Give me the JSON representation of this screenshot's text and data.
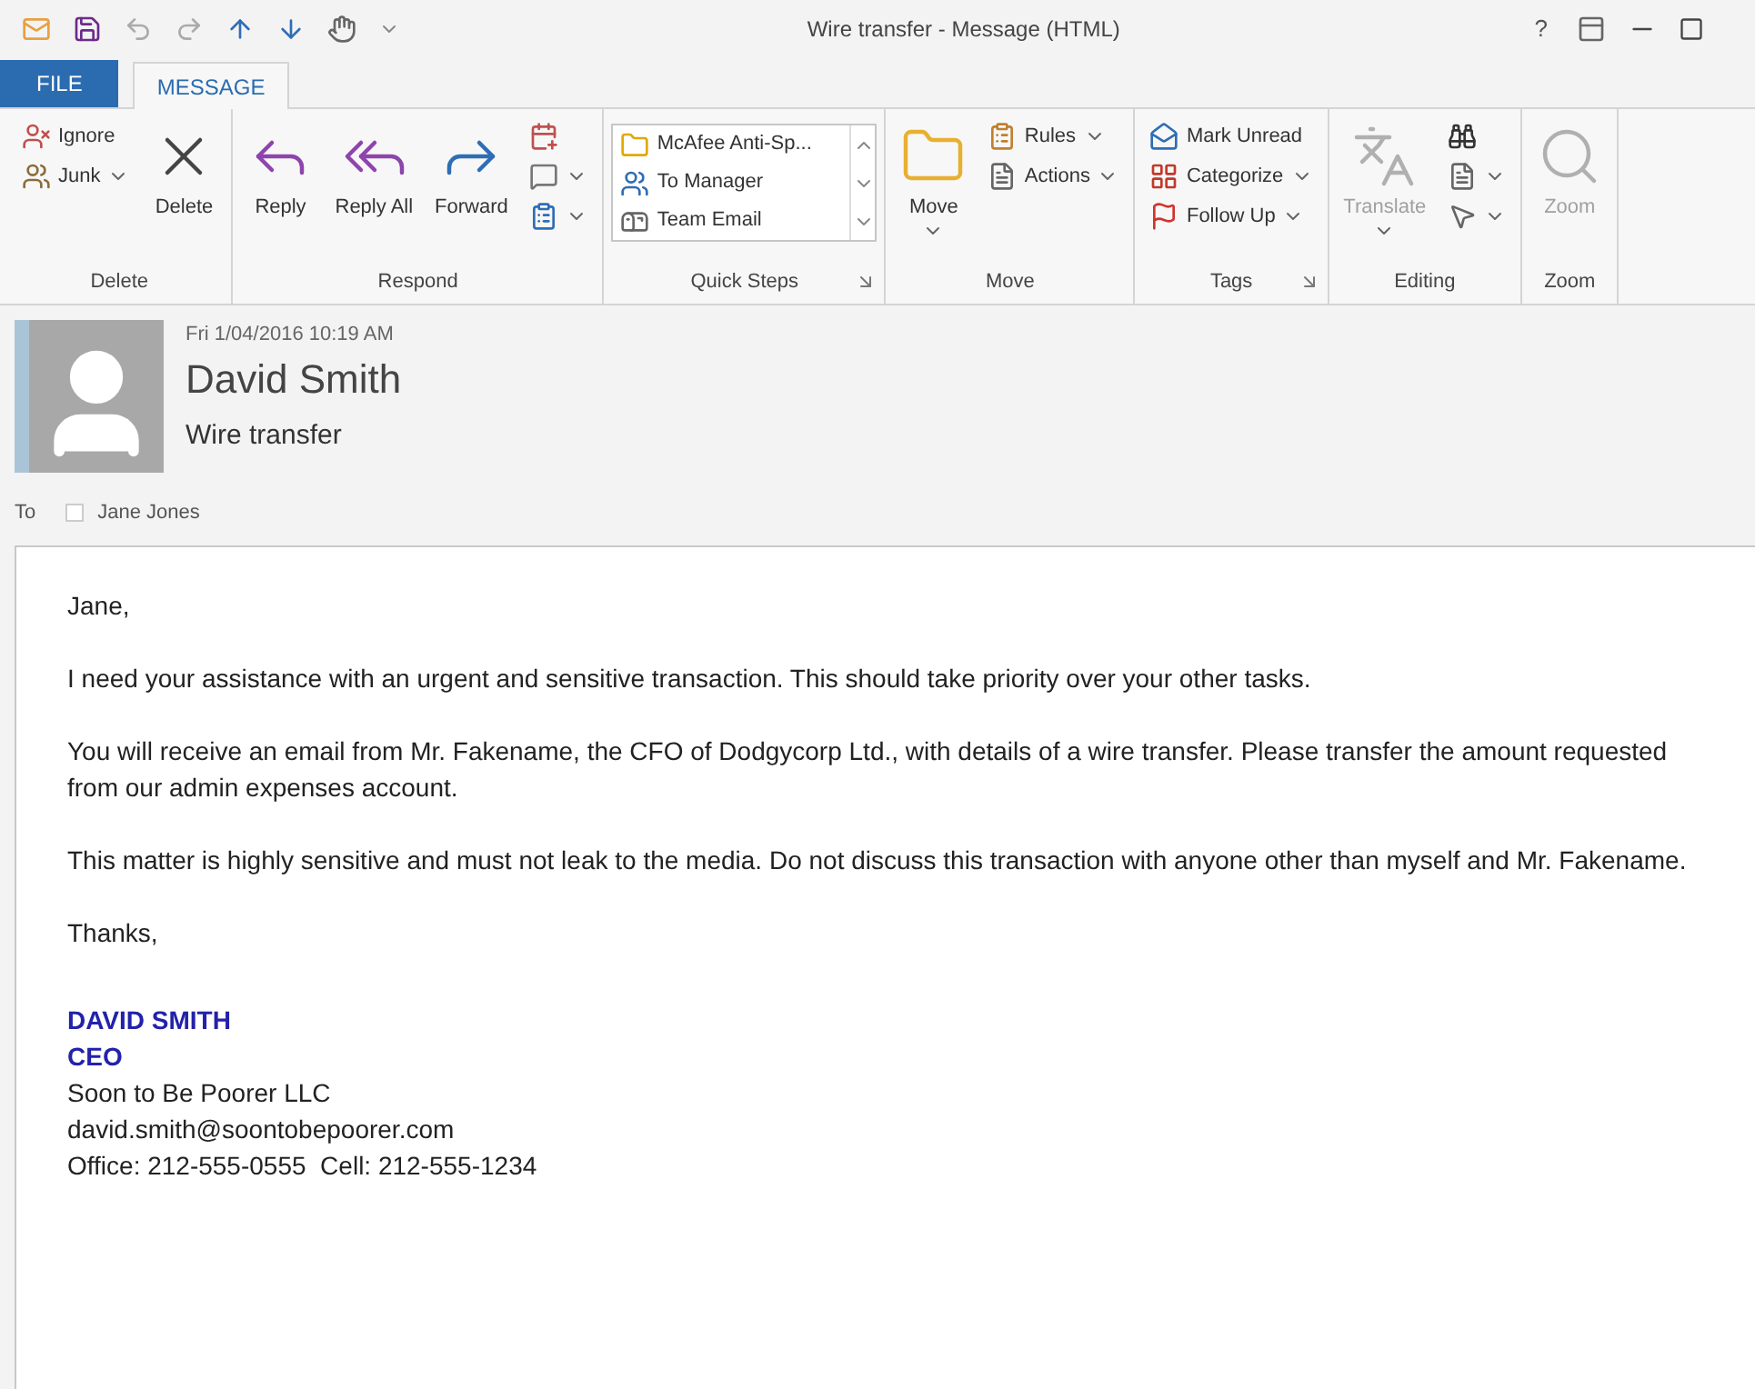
{
  "window": {
    "title": "Wire transfer - Message (HTML)",
    "controls": [
      "?"
    ]
  },
  "tabs": [
    {
      "label": "FILE",
      "kind": "file",
      "selected": false
    },
    {
      "label": "MESSAGE",
      "kind": "tab",
      "selected": true
    }
  ],
  "ribbon": [
    {
      "label": "Delete",
      "launcher": false,
      "buttons": [
        {
          "kind": "small",
          "label": "Ignore",
          "dropdown": false,
          "disabled": false
        },
        {
          "kind": "small",
          "label": "Junk",
          "dropdown": true,
          "disabled": false
        },
        {
          "kind": "large",
          "label": "Delete",
          "dropdown": false,
          "disabled": false
        }
      ]
    },
    {
      "label": "Respond",
      "launcher": false,
      "buttons": [
        {
          "kind": "large",
          "label": "Reply",
          "dropdown": false,
          "disabled": false
        },
        {
          "kind": "large",
          "label": "Reply All",
          "dropdown": false,
          "disabled": false
        },
        {
          "kind": "large",
          "label": "Forward",
          "dropdown": false,
          "disabled": false
        },
        {
          "kind": "small",
          "dropdown": false,
          "disabled": false
        },
        {
          "kind": "small",
          "dropdown": true,
          "disabled": false
        },
        {
          "kind": "small",
          "dropdown": true,
          "disabled": false
        }
      ]
    },
    {
      "label": "Quick Steps",
      "launcher": true,
      "buttons": [
        {
          "kind": "gallery",
          "items": [
            "McAfee Anti-Sp...",
            "To Manager",
            "Team Email"
          ]
        }
      ]
    },
    {
      "label": "Move",
      "launcher": false,
      "buttons": [
        {
          "kind": "large",
          "label": "Move",
          "dropdown": true,
          "disabled": false
        },
        {
          "kind": "small",
          "label": "Rules",
          "dropdown": true,
          "disabled": false
        },
        {
          "kind": "small",
          "label": "Actions",
          "dropdown": true,
          "disabled": false
        }
      ]
    },
    {
      "label": "Tags",
      "launcher": true,
      "buttons": [
        {
          "kind": "small",
          "label": "Mark Unread",
          "dropdown": false,
          "disabled": false
        },
        {
          "kind": "small",
          "label": "Categorize",
          "dropdown": true,
          "disabled": false
        },
        {
          "kind": "small",
          "label": "Follow Up",
          "dropdown": true,
          "disabled": false
        }
      ]
    },
    {
      "label": "Editing",
      "launcher": false,
      "buttons": [
        {
          "kind": "large",
          "label": "Translate",
          "dropdown": true,
          "disabled": true
        },
        {
          "kind": "small",
          "dropdown": false,
          "disabled": false
        },
        {
          "kind": "small",
          "dropdown": true,
          "disabled": false
        },
        {
          "kind": "small",
          "dropdown": true,
          "disabled": false
        }
      ]
    },
    {
      "label": "Zoom",
      "launcher": false,
      "buttons": [
        {
          "kind": "large",
          "label": "Zoom",
          "dropdown": false,
          "disabled": true
        }
      ]
    }
  ],
  "header": {
    "date": "Fri 1/04/2016 10:19 AM",
    "sender": "David Smith",
    "subject": "Wire transfer",
    "to_label": "To",
    "recipient_checked": false,
    "recipient": "Jane Jones"
  },
  "body": [
    "Jane,",
    "I need your assistance with an urgent and sensitive transaction. This should take priority over your other tasks.",
    "You will receive an email from Mr. Fakename, the CFO of Dodgycorp Ltd., with details of a wire transfer. Please transfer the amount requested from our admin expenses account.",
    "This matter is highly sensitive and must not leak to the media. Do not discuss this transaction with anyone other than myself and Mr. Fakename.",
    "Thanks,"
  ],
  "signature": [
    {
      "kind": "name",
      "text": "DAVID SMITH"
    },
    {
      "kind": "title",
      "text": "CEO"
    },
    {
      "kind": "plain",
      "text": "Soon to Be Poorer LLC"
    },
    {
      "kind": "plain",
      "text": "david.smith@soontobepoorer.com"
    },
    {
      "kind": "plain",
      "text": "Office: 212-555-0555  Cell: 212-555-1234"
    }
  ]
}
